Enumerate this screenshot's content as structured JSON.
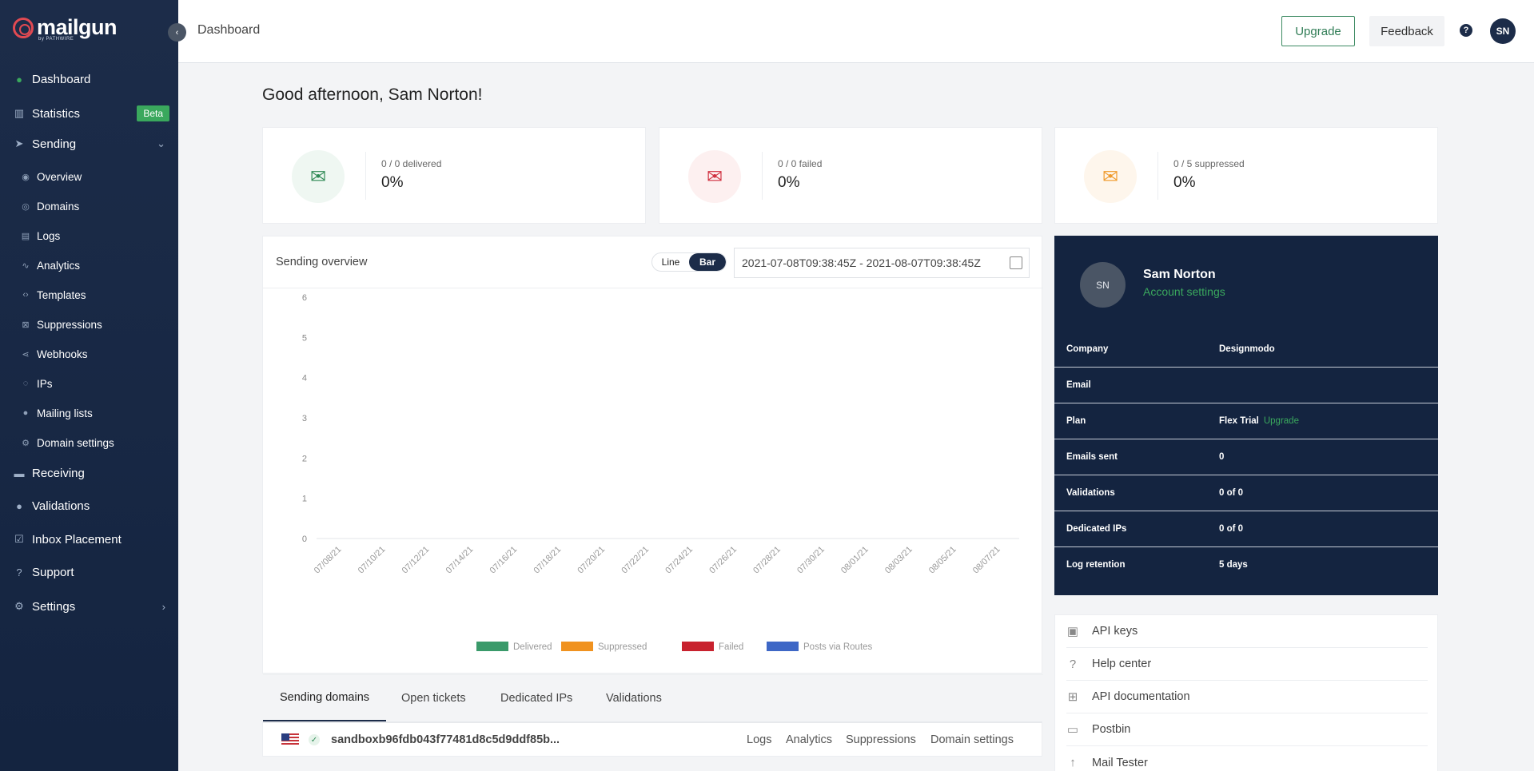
{
  "brand": {
    "name": "mailgun",
    "sub": "by PATHWIRE"
  },
  "sidebar": {
    "main_items": [
      {
        "label": "Dashboard"
      },
      {
        "label": "Statistics",
        "badge": "Beta"
      },
      {
        "label": "Sending"
      }
    ],
    "sending_items": [
      {
        "label": "Overview"
      },
      {
        "label": "Domains"
      },
      {
        "label": "Logs"
      },
      {
        "label": "Analytics"
      },
      {
        "label": "Templates"
      },
      {
        "label": "Suppressions"
      },
      {
        "label": "Webhooks"
      },
      {
        "label": "IPs"
      },
      {
        "label": "Mailing lists"
      },
      {
        "label": "Domain settings"
      }
    ],
    "bottom_items": [
      {
        "label": "Receiving"
      },
      {
        "label": "Validations"
      },
      {
        "label": "Inbox Placement"
      },
      {
        "label": "Support"
      },
      {
        "label": "Settings"
      }
    ]
  },
  "topbar": {
    "breadcrumb": "Dashboard",
    "upgrade_label": "Upgrade",
    "feedback_label": "Feedback",
    "help_label": "?",
    "avatar_initials": "SN"
  },
  "greeting": "Good afternoon, Sam Norton!",
  "stats": [
    {
      "label": "0 / 0 delivered",
      "value": "0%",
      "color": "#2f8a55"
    },
    {
      "label": "0 / 0 failed",
      "value": "0%",
      "color": "#d0303f"
    },
    {
      "label": "0 / 5 suppressed",
      "value": "0%",
      "color": "#f09a2b"
    }
  ],
  "overview": {
    "title": "Sending overview",
    "toggle": {
      "line": "Line",
      "bar": "Bar",
      "selected": "Bar"
    },
    "date_range": "2021-07-08T09:38:45Z - 2021-08-07T09:38:45Z"
  },
  "chart_data": {
    "type": "bar",
    "categories": [
      "07/08/21",
      "07/10/21",
      "07/12/21",
      "07/14/21",
      "07/16/21",
      "07/18/21",
      "07/20/21",
      "07/22/21",
      "07/24/21",
      "07/26/21",
      "07/28/21",
      "07/30/21",
      "08/01/21",
      "08/03/21",
      "08/05/21",
      "08/07/21"
    ],
    "series": [
      {
        "name": "Delivered",
        "color": "#3a9a6a",
        "values": [
          0,
          0,
          0,
          0,
          0,
          0,
          0,
          0,
          0,
          0,
          0,
          0,
          0,
          0,
          0,
          0
        ]
      },
      {
        "name": "Suppressed",
        "color": "#f0921f",
        "values": [
          0,
          0,
          0,
          0,
          0,
          0,
          0,
          0,
          0,
          0,
          0,
          0,
          0,
          0,
          0,
          0
        ]
      },
      {
        "name": "Failed",
        "color": "#c8222e",
        "values": [
          0,
          0,
          0,
          0,
          0,
          0,
          0,
          0,
          0,
          0,
          0,
          0,
          0,
          0,
          0,
          0
        ]
      },
      {
        "name": "Posts via Routes",
        "color": "#3e67c6",
        "values": [
          0,
          0,
          0,
          0,
          0,
          0,
          0,
          0,
          0,
          0,
          0,
          0,
          0,
          0,
          0,
          0
        ]
      }
    ],
    "yticks": [
      "0",
      "1",
      "2",
      "3",
      "4",
      "5",
      "6"
    ],
    "ylim": [
      0,
      6
    ],
    "legend": "bottom"
  },
  "tabs": [
    {
      "label": "Sending domains"
    },
    {
      "label": "Open tickets"
    },
    {
      "label": "Dedicated IPs"
    },
    {
      "label": "Validations"
    }
  ],
  "domain_row": {
    "name": "sandboxb96fdb043f77481d8c5d9ddf85b...",
    "links": [
      "Logs",
      "Analytics",
      "Suppressions",
      "Domain settings"
    ]
  },
  "profile": {
    "initials": "SN",
    "name": "Sam Norton",
    "account_link": "Account settings",
    "rows": [
      {
        "key": "Company",
        "value": "Designmodo"
      },
      {
        "key": "Email",
        "value": ""
      },
      {
        "key": "Plan",
        "value": "Flex Trial",
        "extra": "Upgrade"
      },
      {
        "key": "Emails sent",
        "value": "0"
      },
      {
        "key": "Validations",
        "value": "0 of 0"
      },
      {
        "key": "Dedicated IPs",
        "value": "0 of 0"
      },
      {
        "key": "Log retention",
        "value": "5 days"
      }
    ]
  },
  "quick_links": [
    {
      "label": "API keys",
      "icon": "lock-icon"
    },
    {
      "label": "Help center",
      "icon": "question-icon"
    },
    {
      "label": "API documentation",
      "icon": "grid-icon"
    },
    {
      "label": "Postbin",
      "icon": "inbox-icon"
    },
    {
      "label": "Mail Tester",
      "icon": "tester-icon"
    }
  ]
}
